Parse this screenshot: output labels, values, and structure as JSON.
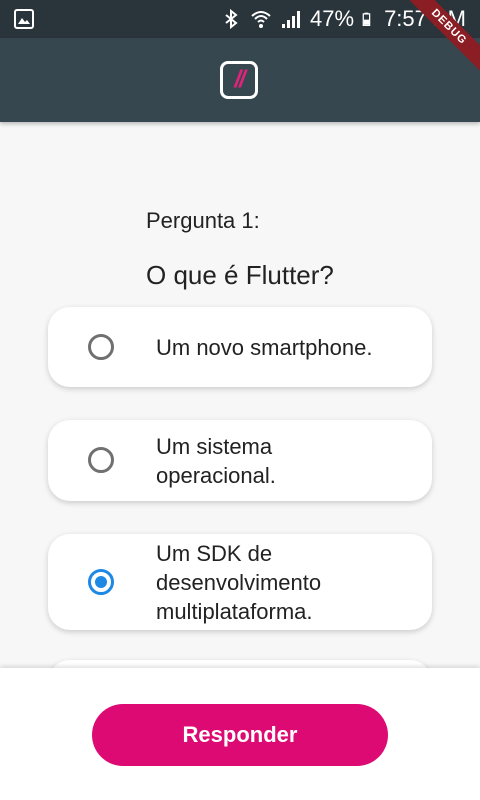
{
  "status_bar": {
    "battery": "47%",
    "time": "7:57 PM",
    "icons": [
      "image-icon",
      "bluetooth-icon",
      "wifi-icon",
      "signal-icon",
      "battery-charging-icon"
    ]
  },
  "debug_banner": "DEBUG",
  "app_bar": {
    "logo_text": "//"
  },
  "question": {
    "label": "Pergunta 1:",
    "text": "O que é Flutter?"
  },
  "options": [
    {
      "text": "Um novo smartphone.",
      "selected": false
    },
    {
      "text": "Um sistema operacional.",
      "selected": false
    },
    {
      "text": "Um SDK de desenvolvimento multiplataforma.",
      "selected": true
    }
  ],
  "submit_label": "Responder",
  "colors": {
    "status_bar": "#2a343b",
    "app_bar": "#37474f",
    "accent": "#dd0a73",
    "radio_selected": "#1e88e5"
  }
}
